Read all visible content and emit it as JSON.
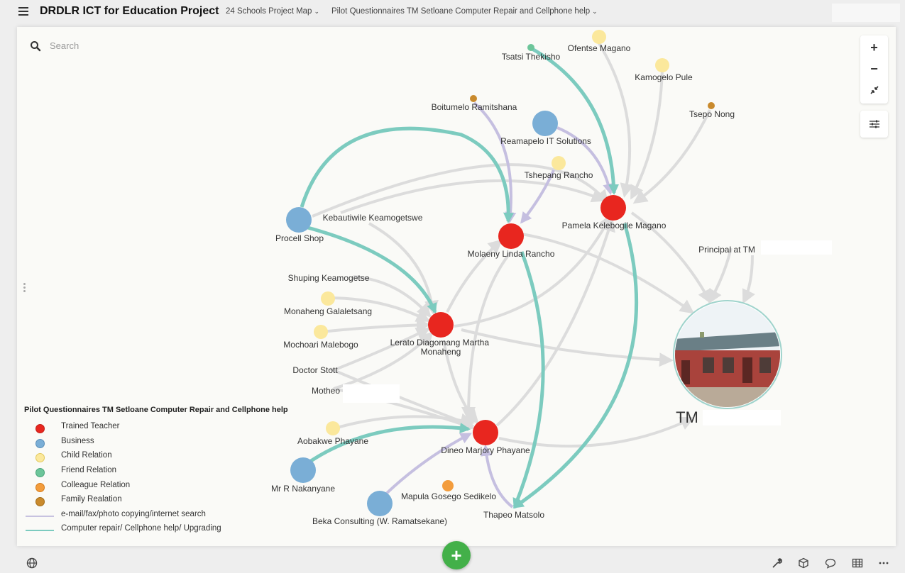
{
  "app": {
    "title": "DRDLR ICT for Education Project",
    "breadcrumbs": [
      "24 Schools Project Map",
      "Pilot Questionnaires TM Setloane Computer Repair and Cellphone help"
    ]
  },
  "search": {
    "placeholder": "Search"
  },
  "map": {
    "nodes": [
      {
        "id": "tsatsi",
        "label": "Tsatsi Thekisho",
        "type": "Friend Relation"
      },
      {
        "id": "ofentse",
        "label": "Ofentse Magano",
        "type": "Child Relation"
      },
      {
        "id": "kamogelo",
        "label": "Kamogelo Pule",
        "type": "Child Relation"
      },
      {
        "id": "tsepo",
        "label": "Tsepo Nong",
        "type": "Family Realation"
      },
      {
        "id": "boitumelo",
        "label": "Boitumelo Ramitshana",
        "type": "Family Realation"
      },
      {
        "id": "reamapelo",
        "label": "Reamapelo IT Solutions",
        "type": "Business"
      },
      {
        "id": "tshepang",
        "label": "Tshepang Rancho",
        "type": "Child Relation"
      },
      {
        "id": "pamela",
        "label": "Pamela Kelebogile Magano",
        "type": "Trained Teacher"
      },
      {
        "id": "procell",
        "label": "Procell Shop",
        "type": "Business"
      },
      {
        "id": "kebautiwile",
        "label": "Kebautiwile Keamogetswe",
        "type": ""
      },
      {
        "id": "molaeny",
        "label": "Molaeny Linda Rancho",
        "type": "Trained Teacher"
      },
      {
        "id": "principal",
        "label": "Principal at TM",
        "type": ""
      },
      {
        "id": "shuping",
        "label": "Shuping Keamogetse",
        "type": ""
      },
      {
        "id": "monaheng",
        "label": "Monaheng Galaletsang",
        "type": "Child Relation"
      },
      {
        "id": "lerato",
        "label": "Lerato Diagomang Martha Monaheng",
        "type": "Trained Teacher"
      },
      {
        "id": "mochoari",
        "label": "Mochoari Malebogo",
        "type": "Child Relation"
      },
      {
        "id": "doctor",
        "label": "Doctor Stott",
        "type": ""
      },
      {
        "id": "motheo",
        "label": "Motheo",
        "type": ""
      },
      {
        "id": "tm",
        "label": "TM",
        "type": "School"
      },
      {
        "id": "aobakwe",
        "label": "Aobakwe Phayane",
        "type": "Child Relation"
      },
      {
        "id": "dineo",
        "label": "Dineo Marjory Phayane",
        "type": "Trained Teacher"
      },
      {
        "id": "nakanyane",
        "label": "Mr R Nakanyane",
        "type": "Business"
      },
      {
        "id": "mapula",
        "label": "Mapula Gosego Sedikelo",
        "type": "Colleague Relation"
      },
      {
        "id": "beka",
        "label": "Beka Consulting (W. Ramatsekane)",
        "type": "Business"
      },
      {
        "id": "thapeo",
        "label": "Thapeo Matsolo",
        "type": ""
      }
    ]
  },
  "legend": {
    "title": "Pilot Questionnaires TM Setloane Computer Repair and Cellphone help",
    "items": [
      {
        "label": "Trained Teacher",
        "color": "#e8261f"
      },
      {
        "label": "Business",
        "color": "#7aaed6"
      },
      {
        "label": "Child Relation",
        "color": "#fbe89c"
      },
      {
        "label": "Friend Relation",
        "color": "#6cc59a"
      },
      {
        "label": "Colleague Relation",
        "color": "#f39c3c"
      },
      {
        "label": "Family Realation",
        "color": "#c98a2d"
      },
      {
        "label": "e-mail/fax/photo copying/internet search",
        "color": "#c7c2e0"
      },
      {
        "label": "Computer repair/ Cellphone help/ Upgrading",
        "color": "#7ccbbf"
      }
    ]
  },
  "controls": {
    "zoom_in": "+",
    "zoom_out": "−",
    "add": "+"
  },
  "colors": {
    "teal": "#7ccbbf",
    "lavender": "#c5bfe0",
    "grey_edge": "#dcdcdc",
    "add_button": "#43b049"
  }
}
